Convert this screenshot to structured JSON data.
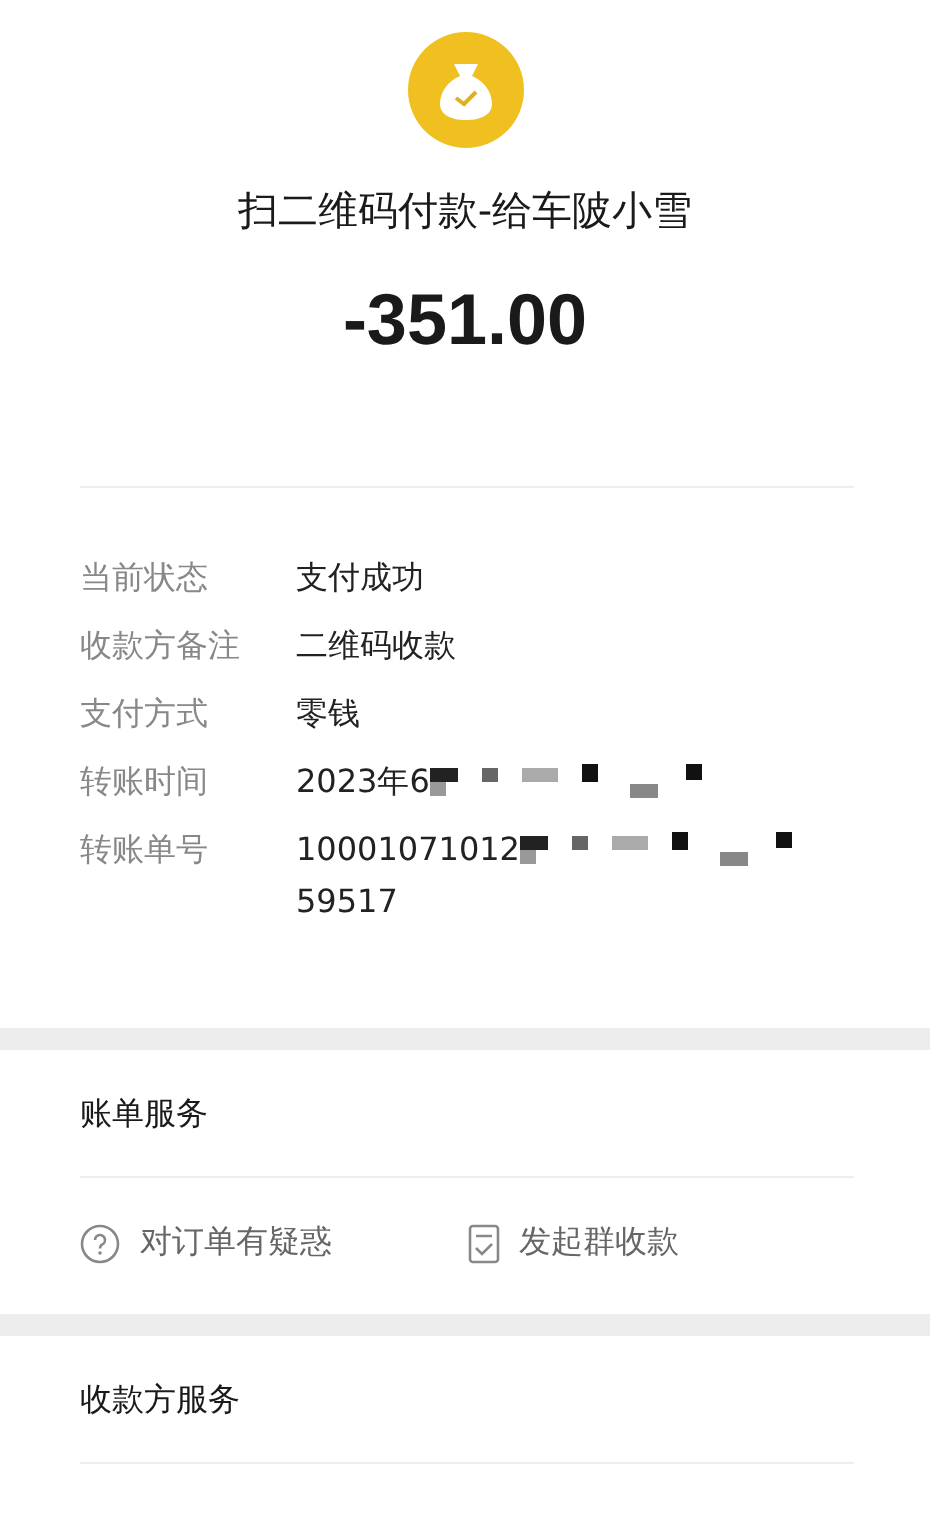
{
  "header": {
    "title": "扫二维码付款-给车陂小雪",
    "amount": "-351.00"
  },
  "details": [
    {
      "label": "当前状态",
      "value": "支付成功",
      "redacted": false
    },
    {
      "label": "收款方备注",
      "value": "二维码收款",
      "redacted": false
    },
    {
      "label": "支付方式",
      "value": "零钱",
      "redacted": false
    },
    {
      "label": "转账时间",
      "value": "2023年6",
      "redacted": true
    },
    {
      "label": "转账单号",
      "value": "10001071012",
      "redacted": true,
      "value_line_2": "59517"
    }
  ],
  "bill_services": {
    "title": "账单服务",
    "actions": [
      {
        "kind": "question",
        "label": "对订单有疑惑"
      },
      {
        "kind": "document",
        "label": "发起群收款"
      }
    ]
  },
  "payee_services": {
    "title": "收款方服务"
  }
}
